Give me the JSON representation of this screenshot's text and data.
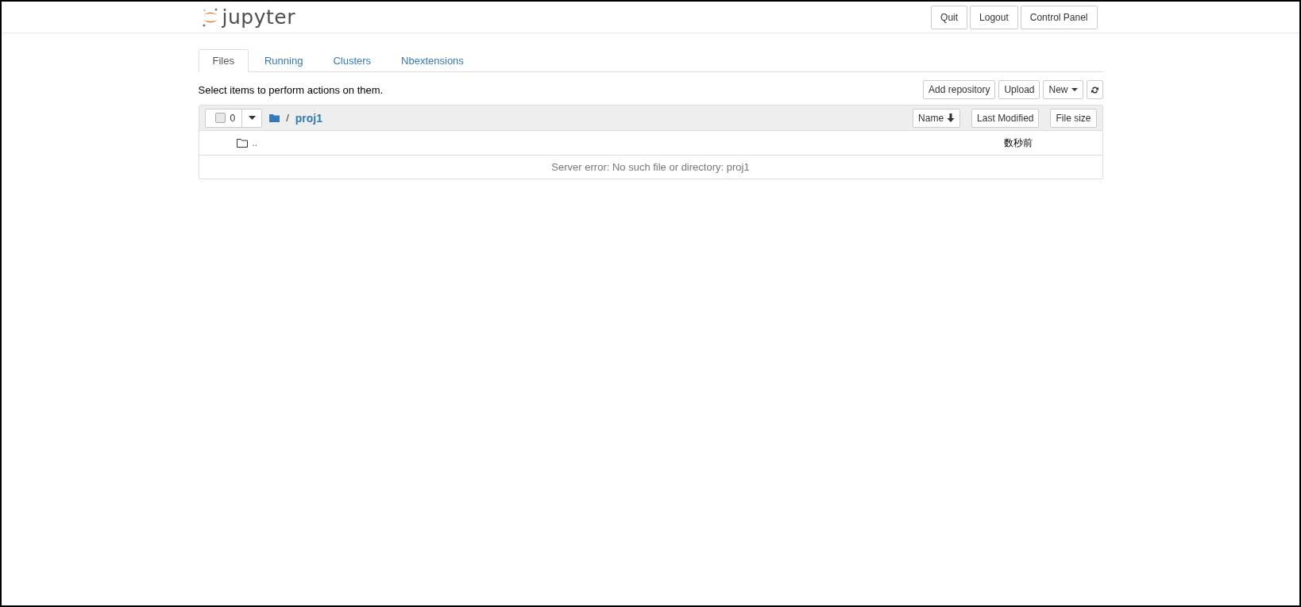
{
  "header": {
    "logo": "jupyter",
    "buttons": [
      "Quit",
      "Logout",
      "Control Panel"
    ]
  },
  "tabs": [
    {
      "label": "Files",
      "selected": true
    },
    {
      "label": "Running",
      "selected": false
    },
    {
      "label": "Clusters",
      "selected": false
    },
    {
      "label": "Nbextensions",
      "selected": false
    }
  ],
  "toolbar": {
    "hint": "Select items to perform actions on them.",
    "buttons": [
      "Add repository",
      "Upload",
      "New"
    ]
  },
  "file_list": {
    "select_count": "0",
    "select_all_checked": false,
    "breadcrumb_root": "/",
    "breadcrumb_folder": "proj1",
    "sort_buttons": [
      {
        "label": "Name",
        "sorted": true
      },
      {
        "label": "Last Modified",
        "sorted": false
      },
      {
        "label": "File size",
        "sorted": false
      }
    ],
    "rows": [
      {
        "name": "..",
        "modified": "数秒前"
      }
    ],
    "message": "Server error: No such file or directory: proj1"
  }
}
